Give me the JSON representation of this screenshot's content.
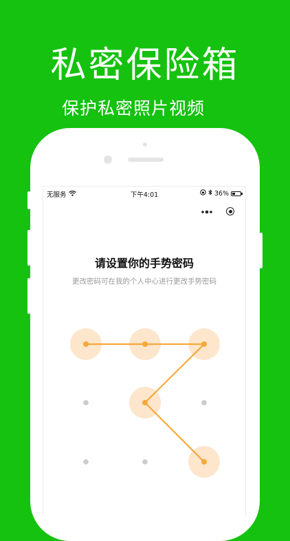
{
  "promo": {
    "title": "私密保险箱",
    "subtitle": "保护私密照片视频"
  },
  "status_bar": {
    "carrier": "无服务",
    "time": "下午4:01",
    "battery_percent": "36%",
    "battery_level": 0.36
  },
  "mini_program_capsule": {
    "more_icon": "ellipsis-icon",
    "close_icon": "target-icon"
  },
  "page": {
    "title": "请设置你的手势密码",
    "hint": "更改密码可在我的个人中心进行更改手势密码"
  },
  "gesture": {
    "grid": [
      [
        "1",
        "2",
        "3"
      ],
      [
        "4",
        "5",
        "6"
      ],
      [
        "7",
        "8",
        "9"
      ]
    ],
    "path": [
      "1",
      "2",
      "3",
      "5",
      "9"
    ],
    "active_color": "#f5a83a",
    "active_halo": "#fde6cc",
    "idle_color": "#cccccc"
  },
  "colors": {
    "background": "#15c20f",
    "phone": "#ffffff"
  }
}
